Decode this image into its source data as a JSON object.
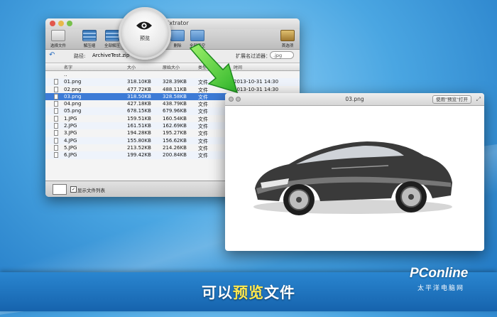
{
  "window": {
    "title": "7zExtrator",
    "toolbar": [
      {
        "label": "选择文件"
      },
      {
        "label": "解压缩"
      },
      {
        "label": "全部解压"
      },
      {
        "label": "缩"
      },
      {
        "label": "删除"
      },
      {
        "label": "全部清空"
      },
      {
        "label": "首选项"
      }
    ],
    "path_label": "路径:",
    "path_value": "ArchiveTest.zip",
    "filter_label": "扩展名过滤器：",
    "filter_value": ".jpg",
    "columns": [
      "名字",
      "大小",
      "原始大小",
      "类型",
      "时间"
    ],
    "rows": [
      {
        "name": "..",
        "size": "",
        "orig": "",
        "type": "",
        "date": ""
      },
      {
        "name": "01.png",
        "size": "318.10KB",
        "orig": "328.39KB",
        "type": "文件",
        "date": "2013-10-31 14:30"
      },
      {
        "name": "02.png",
        "size": "477.72KB",
        "orig": "488.11KB",
        "type": "文件",
        "date": "2013-10-31 14:30"
      },
      {
        "name": "03.png",
        "size": "318.50KB",
        "orig": "328.58KB",
        "type": "文件",
        "date": ""
      },
      {
        "name": "04.png",
        "size": "427.18KB",
        "orig": "438.79KB",
        "type": "文件",
        "date": ""
      },
      {
        "name": "05.png",
        "size": "678.15KB",
        "orig": "679.96KB",
        "type": "文件",
        "date": ""
      },
      {
        "name": "1.JPG",
        "size": "159.51KB",
        "orig": "160.54KB",
        "type": "文件",
        "date": ""
      },
      {
        "name": "2.JPG",
        "size": "161.51KB",
        "orig": "162.69KB",
        "type": "文件",
        "date": ""
      },
      {
        "name": "3.JPG",
        "size": "194.28KB",
        "orig": "195.27KB",
        "type": "文件",
        "date": ""
      },
      {
        "name": "4.JPG",
        "size": "155.80KB",
        "orig": "156.62KB",
        "type": "文件",
        "date": ""
      },
      {
        "name": "5.JPG",
        "size": "213.52KB",
        "orig": "214.26KB",
        "type": "文件",
        "date": ""
      },
      {
        "name": "6.JPG",
        "size": "199.42KB",
        "orig": "200.84KB",
        "type": "文件",
        "date": ""
      }
    ],
    "selected_row": 3,
    "show_list_label": "显示文件列表",
    "show_list_checked": "✓"
  },
  "magnifier": {
    "label": "预览",
    "icon": "eye-icon"
  },
  "preview": {
    "filename": "03.png",
    "open_button": "使用\"预览\"打开",
    "fullscreen_glyph": "⤢"
  },
  "banner": {
    "caption_pre": "可以",
    "caption_highlight": "预览",
    "caption_post": "文件",
    "logo": "PConline",
    "logo_sub": "太平洋电脑网"
  },
  "colors": {
    "background": "#4aa6e2",
    "selection": "#3d7bd6",
    "arrow": "#4cd137",
    "highlight_text": "#ffe84d"
  }
}
